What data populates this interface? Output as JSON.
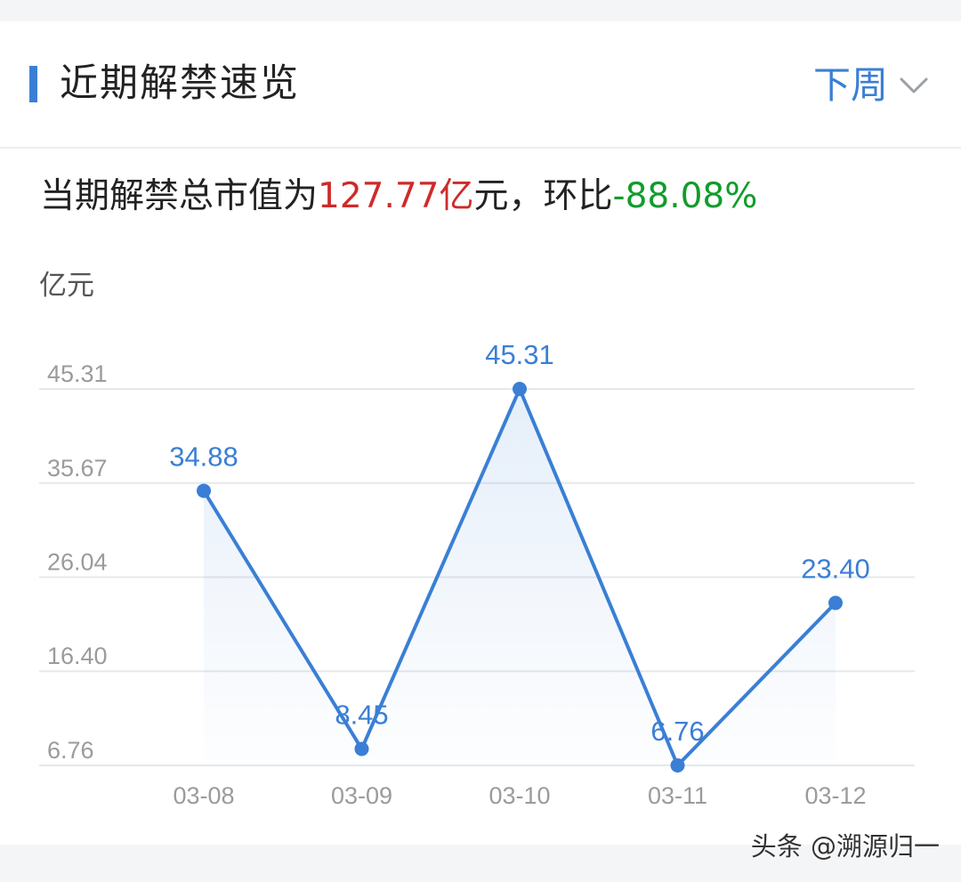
{
  "header": {
    "title": "近期解禁速览",
    "period_label": "下周",
    "period_icon": "chevron-down-icon"
  },
  "summary": {
    "prefix": "当期解禁总市值为",
    "amount": "127.77亿",
    "mid": "元，环比",
    "change": "-88.08%"
  },
  "watermark": "头条 @溯源归一",
  "colors": {
    "accent": "#3a7fd5",
    "amount_red": "#cf2a2a",
    "change_green": "#119c2b",
    "line": "#3a7fd5",
    "grid": "#e6e8eb"
  },
  "chart_data": {
    "type": "line",
    "unit_label": "亿元",
    "categories": [
      "03-08",
      "03-09",
      "03-10",
      "03-11",
      "03-12"
    ],
    "values": [
      34.88,
      8.45,
      45.31,
      6.76,
      23.4
    ],
    "value_labels": [
      "34.88",
      "8.45",
      "45.31",
      "6.76",
      "23.40"
    ],
    "y_ticks": [
      "45.31",
      "35.67",
      "26.04",
      "16.40",
      "6.76"
    ],
    "ylim": [
      6.76,
      45.31
    ],
    "grid": true,
    "legend": "none"
  }
}
